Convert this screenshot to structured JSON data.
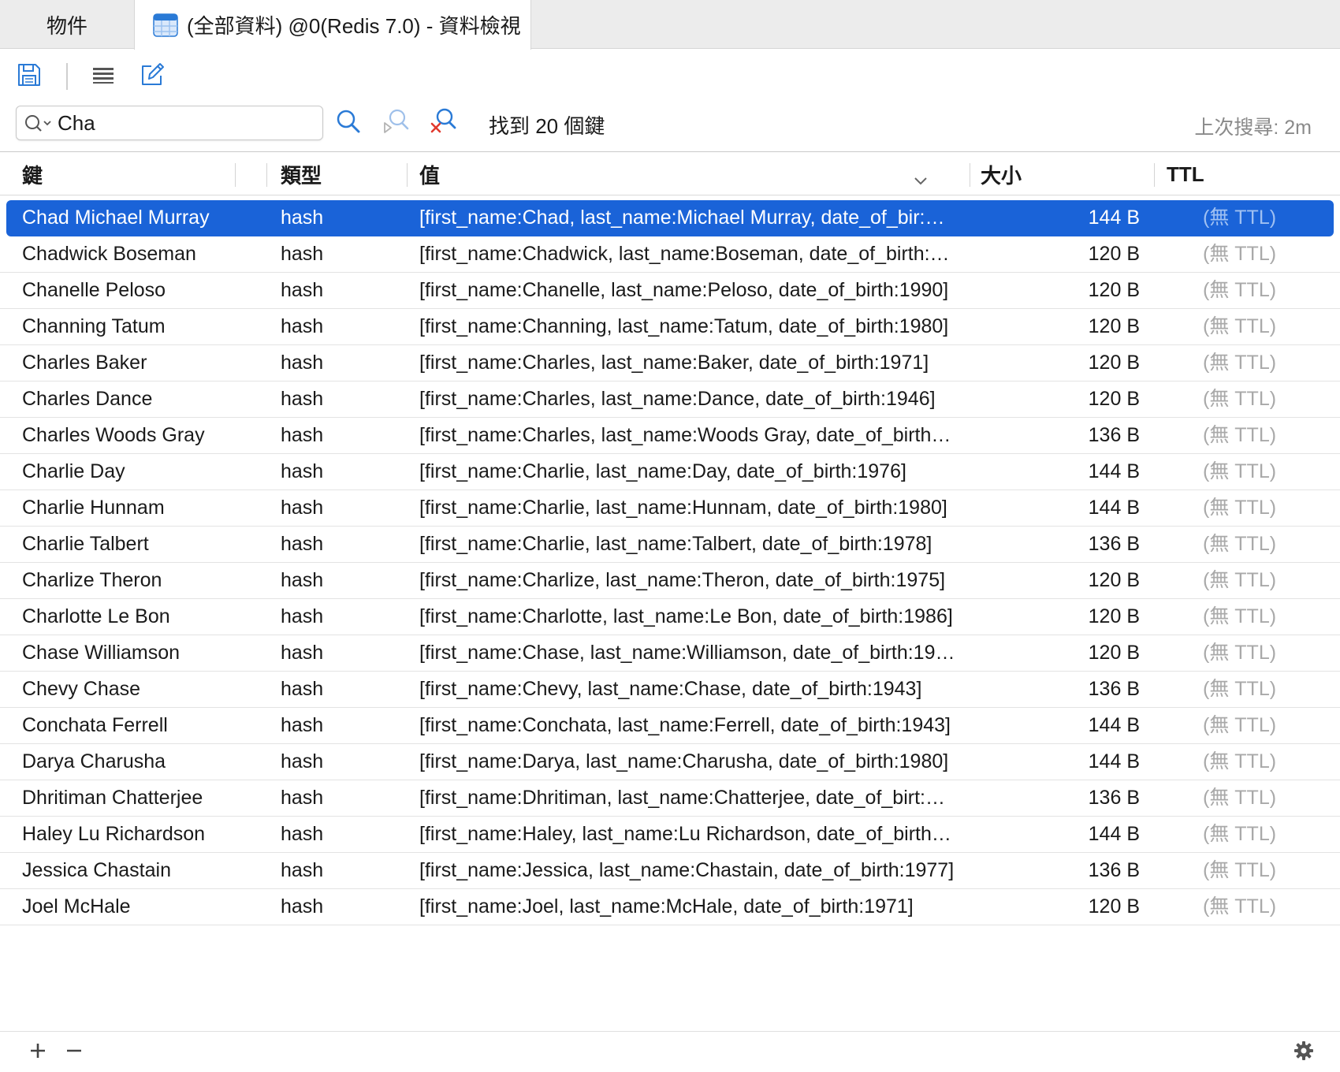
{
  "tabs": {
    "objects_label": "物件",
    "active_label": "(全部資料) @0(Redis 7.0) - 資料檢視"
  },
  "toolbar": {
    "save_icon": "save-icon",
    "list_icon": "list-icon",
    "edit_icon": "edit-icon"
  },
  "search": {
    "value": "Cha",
    "found_text": "找到 20 個鍵",
    "last_search": "上次搜尋: 2m"
  },
  "columns": {
    "key": "鍵",
    "type": "類型",
    "value": "值",
    "size": "大小",
    "ttl": "TTL"
  },
  "rows": [
    {
      "key": "Chad Michael Murray",
      "type": "hash",
      "value": "[first_name:Chad, last_name:Michael Murray, date_of_bir:…",
      "size": "144 B",
      "ttl": "(無 TTL)"
    },
    {
      "key": "Chadwick Boseman",
      "type": "hash",
      "value": "[first_name:Chadwick, last_name:Boseman, date_of_birth:…",
      "size": "120 B",
      "ttl": "(無 TTL)"
    },
    {
      "key": "Chanelle Peloso",
      "type": "hash",
      "value": "[first_name:Chanelle, last_name:Peloso, date_of_birth:1990]",
      "size": "120 B",
      "ttl": "(無 TTL)"
    },
    {
      "key": "Channing Tatum",
      "type": "hash",
      "value": "[first_name:Channing, last_name:Tatum, date_of_birth:1980]",
      "size": "120 B",
      "ttl": "(無 TTL)"
    },
    {
      "key": "Charles Baker",
      "type": "hash",
      "value": "[first_name:Charles, last_name:Baker, date_of_birth:1971]",
      "size": "120 B",
      "ttl": "(無 TTL)"
    },
    {
      "key": "Charles Dance",
      "type": "hash",
      "value": "[first_name:Charles, last_name:Dance, date_of_birth:1946]",
      "size": "120 B",
      "ttl": "(無 TTL)"
    },
    {
      "key": "Charles Woods Gray",
      "type": "hash",
      "value": "[first_name:Charles, last_name:Woods Gray, date_of_birth:…",
      "size": "136 B",
      "ttl": "(無 TTL)"
    },
    {
      "key": "Charlie Day",
      "type": "hash",
      "value": "[first_name:Charlie, last_name:Day, date_of_birth:1976]",
      "size": "144 B",
      "ttl": "(無 TTL)"
    },
    {
      "key": "Charlie Hunnam",
      "type": "hash",
      "value": "[first_name:Charlie, last_name:Hunnam, date_of_birth:1980]",
      "size": "144 B",
      "ttl": "(無 TTL)"
    },
    {
      "key": "Charlie Talbert",
      "type": "hash",
      "value": "[first_name:Charlie, last_name:Talbert, date_of_birth:1978]",
      "size": "136 B",
      "ttl": "(無 TTL)"
    },
    {
      "key": "Charlize Theron",
      "type": "hash",
      "value": "[first_name:Charlize, last_name:Theron, date_of_birth:1975]",
      "size": "120 B",
      "ttl": "(無 TTL)"
    },
    {
      "key": "Charlotte Le Bon",
      "type": "hash",
      "value": "[first_name:Charlotte, last_name:Le Bon, date_of_birth:1986]",
      "size": "120 B",
      "ttl": "(無 TTL)"
    },
    {
      "key": "Chase Williamson",
      "type": "hash",
      "value": "[first_name:Chase, last_name:Williamson, date_of_birth:19…",
      "size": "120 B",
      "ttl": "(無 TTL)"
    },
    {
      "key": "Chevy Chase",
      "type": "hash",
      "value": "[first_name:Chevy, last_name:Chase, date_of_birth:1943]",
      "size": "136 B",
      "ttl": "(無 TTL)"
    },
    {
      "key": "Conchata Ferrell",
      "type": "hash",
      "value": "[first_name:Conchata, last_name:Ferrell, date_of_birth:1943]",
      "size": "144 B",
      "ttl": "(無 TTL)"
    },
    {
      "key": "Darya Charusha",
      "type": "hash",
      "value": "[first_name:Darya, last_name:Charusha, date_of_birth:1980]",
      "size": "144 B",
      "ttl": "(無 TTL)"
    },
    {
      "key": "Dhritiman Chatterjee",
      "type": "hash",
      "value": "[first_name:Dhritiman, last_name:Chatterjee, date_of_birt:…",
      "size": "136 B",
      "ttl": "(無 TTL)"
    },
    {
      "key": "Haley Lu Richardson",
      "type": "hash",
      "value": "[first_name:Haley, last_name:Lu Richardson, date_of_birth:…",
      "size": "144 B",
      "ttl": "(無 TTL)"
    },
    {
      "key": "Jessica Chastain",
      "type": "hash",
      "value": "[first_name:Jessica, last_name:Chastain, date_of_birth:1977]",
      "size": "136 B",
      "ttl": "(無 TTL)"
    },
    {
      "key": "Joel McHale",
      "type": "hash",
      "value": "[first_name:Joel, last_name:McHale, date_of_birth:1971]",
      "size": "120 B",
      "ttl": "(無 TTL)"
    }
  ],
  "selected_row": 0,
  "colors": {
    "selection": "#1a63d8",
    "accent_icon": "#2a7ad6",
    "ttl_text": "#a9a9a9"
  }
}
